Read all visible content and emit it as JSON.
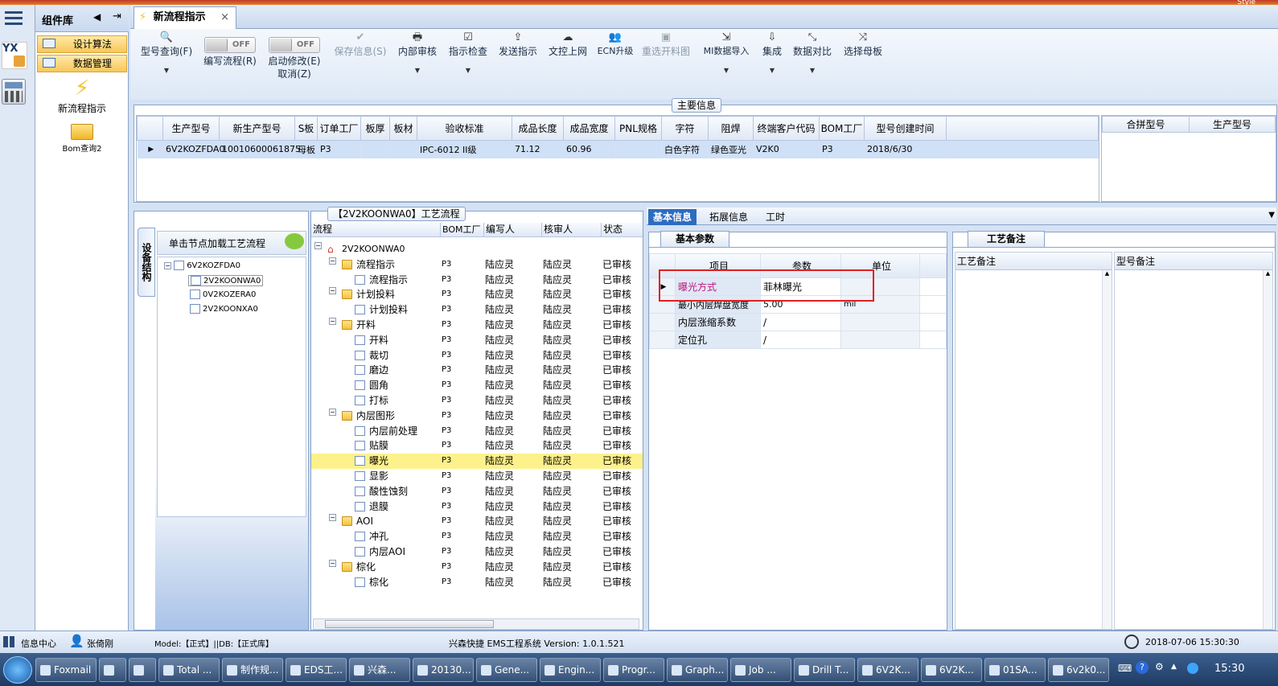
{
  "window": {
    "right_title": "Style"
  },
  "leftbar": {
    "logo_text": "YX"
  },
  "component_panel": {
    "title": "组件库",
    "menus": [
      "设计算法",
      "数据管理"
    ],
    "items": [
      {
        "label": "新流程指示",
        "icon": "lightning-icon"
      },
      {
        "label": "Bom查询2",
        "icon": "folder-icon"
      }
    ]
  },
  "tab": {
    "label": "新流程指示",
    "close": "×"
  },
  "toolbar": {
    "model_query": "型号查询(F)",
    "edit_flow": "编写流程(R)",
    "auto_modify": "启动修改(E)",
    "cancel": "取消(Z)",
    "toggle_off": "OFF",
    "save_info": "保存信息(S)",
    "internal_review": "内部审核",
    "directive_check": "指示检查",
    "send_directive": "发送指示",
    "doc_upload": "文控上网",
    "ecn_upgrade": "ECN升级",
    "reselect_cut": "重选开料图",
    "mi_import": "MI数据导入",
    "integrate": "集成",
    "data_compare": "数据对比",
    "select_mother": "选择母板"
  },
  "main_info": {
    "title": "主要信息",
    "columns": [
      "生产型号",
      "新生产型号",
      "S板",
      "订单工厂",
      "板厚",
      "板材",
      "验收标准",
      "成品长度",
      "成品宽度",
      "PNL规格",
      "字符",
      "阻焊",
      "终端客户代码",
      "BOM工厂",
      "型号创建时间"
    ],
    "row": [
      "6V2KOZFDA0",
      "10010600061875",
      "母板",
      "P3",
      "",
      "",
      "IPC-6012 II级",
      "71.12",
      "60.96",
      "",
      "白色字符",
      "绿色亚光",
      "V2K0",
      "P3",
      "2018/6/30"
    ],
    "merge_columns": [
      "合拼型号",
      "生产型号"
    ]
  },
  "device_tree": {
    "side_tab": "设备结构",
    "header": "单击节点加载工艺流程",
    "root": "6V2KOZFDA0",
    "children": [
      "2V2KOONWA0",
      "0V2KOZERA0",
      "2V2KOONXA0"
    ]
  },
  "process": {
    "title": "【2V2KOONWA0】工艺流程",
    "columns": [
      "流程",
      "BOM工厂",
      "编写人",
      "核审人",
      "状态"
    ],
    "root": "2V2KOONWA0",
    "rows": [
      {
        "name": "流程指示",
        "level": 1,
        "kind": "folder",
        "factory": "P3",
        "writer": "陆应灵",
        "reviewer": "陆应灵",
        "status": "已审核"
      },
      {
        "name": "流程指示",
        "level": 2,
        "kind": "doc",
        "factory": "P3",
        "writer": "陆应灵",
        "reviewer": "陆应灵",
        "status": "已审核"
      },
      {
        "name": "计划投料",
        "level": 1,
        "kind": "folder",
        "factory": "P3",
        "writer": "陆应灵",
        "reviewer": "陆应灵",
        "status": "已审核"
      },
      {
        "name": "计划投料",
        "level": 2,
        "kind": "doc",
        "factory": "P3",
        "writer": "陆应灵",
        "reviewer": "陆应灵",
        "status": "已审核"
      },
      {
        "name": "开料",
        "level": 1,
        "kind": "folder",
        "factory": "P3",
        "writer": "陆应灵",
        "reviewer": "陆应灵",
        "status": "已审核"
      },
      {
        "name": "开料",
        "level": 2,
        "kind": "doc",
        "factory": "P3",
        "writer": "陆应灵",
        "reviewer": "陆应灵",
        "status": "已审核"
      },
      {
        "name": "裁切",
        "level": 2,
        "kind": "doc",
        "factory": "P3",
        "writer": "陆应灵",
        "reviewer": "陆应灵",
        "status": "已审核"
      },
      {
        "name": "磨边",
        "level": 2,
        "kind": "doc",
        "factory": "P3",
        "writer": "陆应灵",
        "reviewer": "陆应灵",
        "status": "已审核"
      },
      {
        "name": "圆角",
        "level": 2,
        "kind": "doc",
        "factory": "P3",
        "writer": "陆应灵",
        "reviewer": "陆应灵",
        "status": "已审核"
      },
      {
        "name": "打标",
        "level": 2,
        "kind": "doc",
        "factory": "P3",
        "writer": "陆应灵",
        "reviewer": "陆应灵",
        "status": "已审核"
      },
      {
        "name": "内层图形",
        "level": 1,
        "kind": "folder",
        "factory": "P3",
        "writer": "陆应灵",
        "reviewer": "陆应灵",
        "status": "已审核"
      },
      {
        "name": "内层前处理",
        "level": 2,
        "kind": "doc",
        "factory": "P3",
        "writer": "陆应灵",
        "reviewer": "陆应灵",
        "status": "已审核"
      },
      {
        "name": "贴膜",
        "level": 2,
        "kind": "doc",
        "factory": "P3",
        "writer": "陆应灵",
        "reviewer": "陆应灵",
        "status": "已审核"
      },
      {
        "name": "曝光",
        "level": 2,
        "kind": "doc",
        "factory": "P3",
        "writer": "陆应灵",
        "reviewer": "陆应灵",
        "status": "已审核",
        "selected": true
      },
      {
        "name": "显影",
        "level": 2,
        "kind": "doc",
        "factory": "P3",
        "writer": "陆应灵",
        "reviewer": "陆应灵",
        "status": "已审核"
      },
      {
        "name": "酸性蚀刻",
        "level": 2,
        "kind": "doc",
        "factory": "P3",
        "writer": "陆应灵",
        "reviewer": "陆应灵",
        "status": "已审核"
      },
      {
        "name": "退膜",
        "level": 2,
        "kind": "doc",
        "factory": "P3",
        "writer": "陆应灵",
        "reviewer": "陆应灵",
        "status": "已审核"
      },
      {
        "name": "AOI",
        "level": 1,
        "kind": "folder",
        "factory": "P3",
        "writer": "陆应灵",
        "reviewer": "陆应灵",
        "status": "已审核"
      },
      {
        "name": "冲孔",
        "level": 2,
        "kind": "doc",
        "factory": "P3",
        "writer": "陆应灵",
        "reviewer": "陆应灵",
        "status": "已审核"
      },
      {
        "name": "内层AOI",
        "level": 2,
        "kind": "doc",
        "factory": "P3",
        "writer": "陆应灵",
        "reviewer": "陆应灵",
        "status": "已审核"
      },
      {
        "name": "棕化",
        "level": 1,
        "kind": "folder",
        "factory": "P3",
        "writer": "陆应灵",
        "reviewer": "陆应灵",
        "status": "已审核"
      },
      {
        "name": "棕化",
        "level": 2,
        "kind": "doc",
        "factory": "P3",
        "writer": "陆应灵",
        "reviewer": "陆应灵",
        "status": "已审核"
      }
    ]
  },
  "detail_tabs": [
    "基本信息",
    "拓展信息",
    "工时"
  ],
  "basic_params": {
    "title": "基本参数",
    "columns": [
      "项目",
      "参数",
      "单位"
    ],
    "rows": [
      {
        "item": "曝光方式",
        "value": "菲林曝光",
        "unit": ""
      },
      {
        "item": "最小内层焊盘宽度",
        "value": "5.00",
        "unit": "mil"
      },
      {
        "item": "内层涨缩系数",
        "value": "/",
        "unit": ""
      },
      {
        "item": "定位孔",
        "value": "/",
        "unit": ""
      }
    ]
  },
  "craft_notes": {
    "title": "工艺备注",
    "columns": [
      "工艺备注",
      "型号备注"
    ]
  },
  "status_bar": {
    "info_center": "信息中心",
    "user": "张倚刚",
    "model_db": "Model:【正式】||DB:【正式库】",
    "system": "兴森快捷 EMS工程系统 Version: 1.0.1.521",
    "datetime": "2018-07-06 15:30:30"
  },
  "taskbar": {
    "items": [
      "Foxmail",
      "",
      "",
      "Total ...",
      "制作规...",
      "EDS工...",
      "兴森...",
      "20130...",
      "Gene...",
      "Engin...",
      "Progr...",
      "Graph...",
      "Job ...",
      "Drill T...",
      "6V2K...",
      "6V2K...",
      "01SA...",
      "6v2k0..."
    ],
    "clock": "15:30"
  },
  "colors": {
    "accent": "#f7c75a",
    "highlight": "#fdf18c",
    "selection": "#cfe0f7",
    "active_tab": "#2d6cc0",
    "red_box": "#e02020"
  }
}
